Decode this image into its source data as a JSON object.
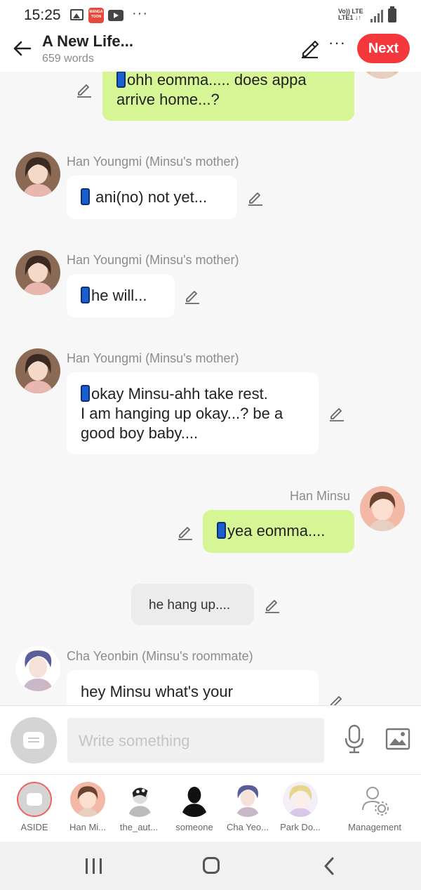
{
  "status_bar": {
    "time": "15:25",
    "manga_icon_text": "MANGA TOON",
    "more": "···",
    "network": "Vo)) LTE",
    "network2": "LTE1 ↓↑"
  },
  "header": {
    "title": "A New Life...",
    "word_count": "659 words",
    "more": "···",
    "next_label": "Next"
  },
  "messages": [
    {
      "type": "self",
      "phone": true,
      "text": "ohh eomma..... does appa\narrive  home...?"
    },
    {
      "type": "other",
      "name": "Han Youngmi (Minsu's mother)",
      "phone": true,
      "text": "ani(no) not yet..."
    },
    {
      "type": "other",
      "name": "Han Youngmi (Minsu's mother)",
      "phone": true,
      "text": "he will..."
    },
    {
      "type": "other",
      "name": "Han Youngmi (Minsu's mother)",
      "phone": true,
      "text": "okay Minsu-ahh take rest.\nI am hanging up okay...? be a\ngood boy baby...."
    },
    {
      "type": "self",
      "name": "Han Minsu",
      "phone": true,
      "text": "yea eomma...."
    },
    {
      "type": "aside",
      "text": "he hang up...."
    },
    {
      "type": "other",
      "name": "Cha Yeonbin (Minsu's roommate)",
      "phone": false,
      "text": "hey Minsu what's your"
    }
  ],
  "input": {
    "placeholder": "Write something"
  },
  "characters": [
    {
      "label": "ASIDE",
      "icon": "aside-icon"
    },
    {
      "label": "Han Mi...",
      "icon": "han-minsu-avatar"
    },
    {
      "label": "the_aut...",
      "icon": "author-avatar"
    },
    {
      "label": "someone",
      "icon": "silhouette-avatar"
    },
    {
      "label": "Cha Yeo...",
      "icon": "cha-yeonbin-avatar"
    },
    {
      "label": "Park Do...",
      "icon": "park-avatar"
    },
    {
      "label": "Management",
      "icon": "user-settings-icon"
    }
  ],
  "colors": {
    "accent": "#f5383c",
    "self_bubble": "#d6f594",
    "other_bubble": "#ffffff",
    "aside_bubble": "#ececec",
    "background": "#f7f7f7"
  }
}
